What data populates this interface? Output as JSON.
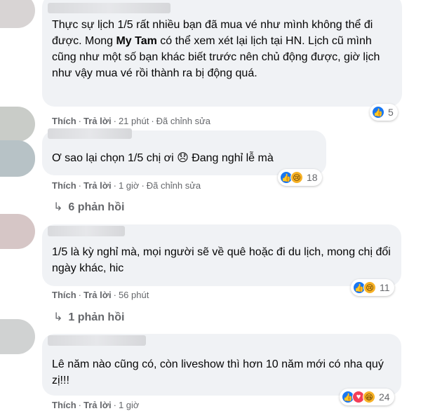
{
  "comments": [
    {
      "text": "Thực sự lịch 1/5 rất nhiều bạn đã mua vé như mình không thể đi được. Mong My Tam có thể xem xét lại lịch tại HN. Lịch cũ mình cũng như một số bạn khác biết trước nên chủ động được, giờ lịch như vậy mua vé rồi thành ra bị động quá.",
      "text_before": "Thực sự lịch 1/5 rất nhiều bạn đã mua vé như mình không thể đi được. Mong ",
      "mention": "My Tam",
      "text_after": " có thể xem xét lại lịch tại HN. Lịch cũ mình cũng như một số bạn khác biết trước nên chủ động được, giờ lịch như vậy mua vé rồi thành ra bị động quá.",
      "like": "Thích",
      "reply": "Trả lời",
      "time": "21 phút",
      "edited": "Đã chỉnh sửa",
      "reaction_count": "5",
      "reactions": [
        "like-icon"
      ]
    },
    {
      "text": "Ơ sao lại chọn 1/5 chị ơi 😞 Đang nghỉ lễ mà",
      "like": "Thích",
      "reply": "Trả lời",
      "time": "1 giờ",
      "edited": "Đã chỉnh sửa",
      "reaction_count": "18",
      "reactions": [
        "like-icon",
        "sad-icon"
      ],
      "replies_label": "6 phản hồi"
    },
    {
      "text": "1/5 là kỳ nghỉ mà, mọi người sẽ về quê hoặc đi du lịch, mong chị đổi ngày khác, hic",
      "like": "Thích",
      "reply": "Trả lời",
      "time": "56 phút",
      "reaction_count": "11",
      "reactions": [
        "like-icon",
        "sad-icon"
      ],
      "replies_label": "1 phản hồi"
    },
    {
      "text": "Lê năm nào cũng có, còn liveshow thì hơn 10 năm mới có nha quý zị!!!",
      "like": "Thích",
      "reply": "Trả lời",
      "time": "1 giờ",
      "reaction_count": "24",
      "reactions": [
        "like-icon",
        "love-icon",
        "haha-icon"
      ]
    }
  ],
  "separator": "·",
  "colors": {
    "bubble": "#f0f2f5",
    "meta": "#65676b",
    "like": "#1877f2",
    "love": "#f33e58",
    "sad": "#f7b125"
  }
}
